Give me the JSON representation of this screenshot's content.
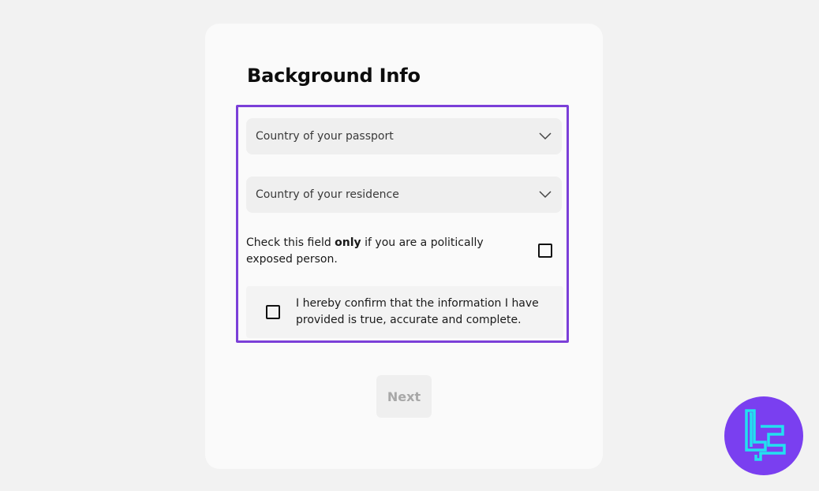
{
  "form": {
    "title": "Background Info",
    "passport_select": {
      "label": "Country of your passport"
    },
    "residence_select": {
      "label": "Country of your residence"
    },
    "pep": {
      "text_before": "Check this field ",
      "text_bold": "only",
      "text_after": " if you are a politically exposed person."
    },
    "confirm": {
      "text": "I hereby confirm that the information I have provided is true, accurate and complete."
    },
    "next_label": "Next"
  },
  "colors": {
    "highlight": "#7b3fd8",
    "logo_bg": "#7a3ff0",
    "logo_fg": "#22e0f0"
  },
  "icons": {
    "select_chevron": "chevron-down-icon",
    "logo": "brand-logo-icon"
  }
}
